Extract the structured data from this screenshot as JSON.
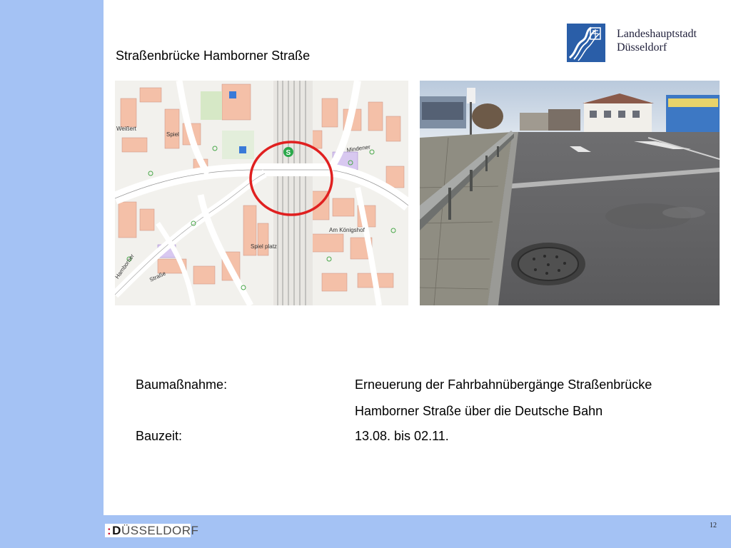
{
  "slide": {
    "title": "Straßenbrücke Hamborner Straße",
    "page_number": "12"
  },
  "header": {
    "city_name_line1": "Landeshauptstadt",
    "city_name_line2": "Düsseldorf"
  },
  "footer": {
    "logo_prefix": ":",
    "logo_d": "D",
    "logo_rest": "ÜSSELDORF"
  },
  "info": {
    "measure_label": "Baumaßnahme:",
    "measure_value_line1": "Erneuerung der Fahrbahnübergänge Straßenbrücke",
    "measure_value_line2": "Hamborner Straße über die Deutsche Bahn",
    "period_label": "Bauzeit:",
    "period_value": "13.08. bis 02.11."
  },
  "map": {
    "street_labels": [
      "Hamborner",
      "Straße",
      "Spiel",
      "Spiel platz",
      "Am Königshof",
      "Mindener",
      "Weißert"
    ],
    "marker_letter": "S",
    "highlight_color": "#e02020"
  },
  "colors": {
    "sidebar": "#a4c2f4",
    "footer": "#a4c2f4",
    "city_logo_blue": "#2a5ea8"
  }
}
